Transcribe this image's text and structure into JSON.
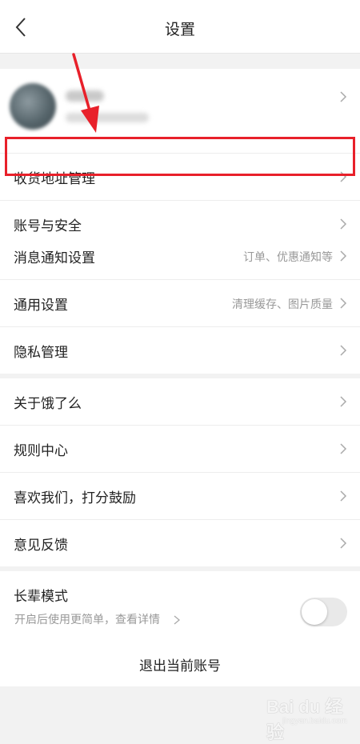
{
  "header": {
    "title": "设置",
    "back_icon": "chevron-left-icon"
  },
  "group1": {
    "profile": {
      "avatar_icon": "avatar"
    },
    "items": [
      {
        "label": "收货地址管理"
      },
      {
        "label": "账号与安全"
      }
    ]
  },
  "group2": {
    "items": [
      {
        "label": "消息通知设置",
        "hint": "订单、优惠通知等"
      },
      {
        "label": "通用设置",
        "hint": "清理缓存、图片质量"
      },
      {
        "label": "隐私管理"
      }
    ]
  },
  "group3": {
    "items": [
      {
        "label": "关于饿了么"
      },
      {
        "label": "规则中心"
      },
      {
        "label": "喜欢我们，打分鼓励"
      },
      {
        "label": "意见反馈"
      }
    ]
  },
  "elder_mode": {
    "label": "长辈模式",
    "sub": "开启后使用更简单，查看详情",
    "enabled": false
  },
  "logout": {
    "label": "退出当前账号"
  },
  "annotation": {
    "highlight_color": "#e8202a"
  },
  "watermark": {
    "main": "Bai du 经验",
    "sub": "jingyan.baidu.com"
  }
}
